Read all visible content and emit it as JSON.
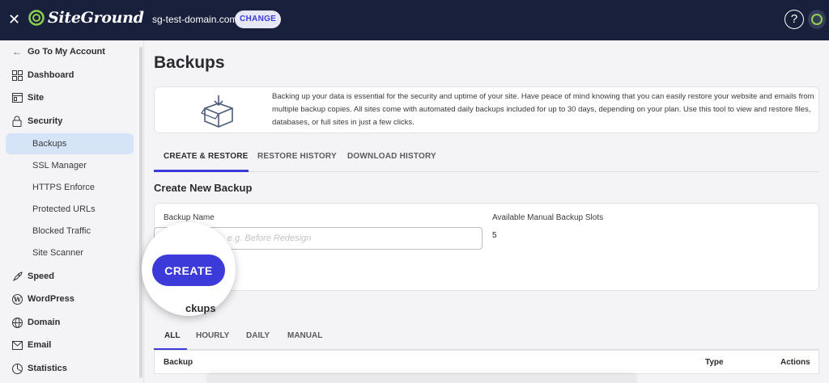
{
  "topbar": {
    "close_icon": "close-icon",
    "brand": "SiteGround",
    "domain": "sg-test-domain.com",
    "change_label": "CHANGE",
    "help_label": "?"
  },
  "sidebar": {
    "back_label": "Go To My Account",
    "items": [
      {
        "label": "Dashboard",
        "icon": "grid-icon"
      },
      {
        "label": "Site",
        "icon": "site-icon"
      },
      {
        "label": "Security",
        "icon": "lock-icon"
      },
      {
        "label": "Speed",
        "icon": "rocket-icon"
      },
      {
        "label": "WordPress",
        "icon": "wordpress-icon"
      },
      {
        "label": "Domain",
        "icon": "globe-icon"
      },
      {
        "label": "Email",
        "icon": "envelope-icon"
      },
      {
        "label": "Statistics",
        "icon": "chart-icon"
      }
    ],
    "security_sub": [
      "Backups",
      "SSL Manager",
      "HTTPS Enforce",
      "Protected URLs",
      "Blocked Traffic",
      "Site Scanner"
    ],
    "active": "Backups"
  },
  "main": {
    "title": "Backups",
    "info_text": "Backing up your data is essential for the security and uptime of your site. Have peace of mind knowing that you can easily restore your website and emails from multiple backup copies. All sites come with automated daily backups included for up to 30 days, depending on your plan. Use this tool to view and restore files, databases, or full sites in just a few clicks.",
    "tabs": [
      "CREATE & RESTORE",
      "RESTORE HISTORY",
      "DOWNLOAD HISTORY"
    ],
    "active_tab": "CREATE & RESTORE",
    "create_section_title": "Create New Backup",
    "backup_name_label": "Backup Name",
    "backup_name_placeholder": "e.g. Before Redesign",
    "slots_label": "Available Manual Backup Slots",
    "slots_value": "5",
    "create_button": "CREATE",
    "manage_section_title": "Manage Backups",
    "manage_section_visible": "ckups",
    "filter_tabs": [
      "ALL",
      "HOURLY",
      "DAILY",
      "MANUAL"
    ],
    "active_filter": "ALL",
    "table_headers": [
      "Backup",
      "Type",
      "Actions"
    ]
  },
  "colors": {
    "topbar": "#19203b",
    "accent": "#3c3ad8",
    "active_bg": "#d5e4f7"
  }
}
